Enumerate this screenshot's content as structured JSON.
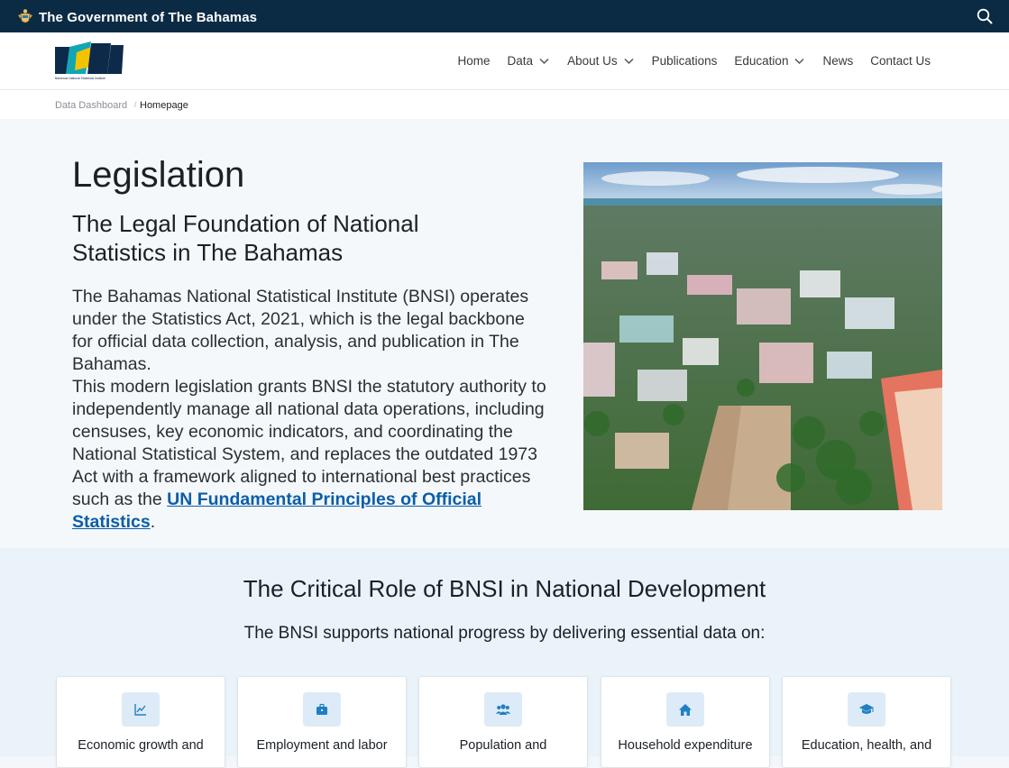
{
  "gov_bar": {
    "title": "The Government of The Bahamas",
    "crest_icon": "coat-of-arms-icon",
    "search_icon": "search-icon"
  },
  "header": {
    "logo_text": "BNSI",
    "logo_caption": "Bahamas National Statistical Institute",
    "nav": [
      {
        "label": "Home",
        "has_dropdown": false
      },
      {
        "label": "Data",
        "has_dropdown": true
      },
      {
        "label": "About Us",
        "has_dropdown": true
      },
      {
        "label": "Publications",
        "has_dropdown": false
      },
      {
        "label": "Education",
        "has_dropdown": true
      },
      {
        "label": "News",
        "has_dropdown": false
      },
      {
        "label": "Contact Us",
        "has_dropdown": false
      }
    ]
  },
  "breadcrumb": {
    "items": [
      "Data Dashboard",
      "Homepage"
    ],
    "separator": "/"
  },
  "hero": {
    "title": "Legislation",
    "subtitle": "The Legal Foundation of National Statistics in The Bahamas",
    "para1": "The Bahamas National Statistical Institute (BNSI) operates under the Statistics Act, 2021, which is the legal backbone for official data collection, analysis, and publication in The Bahamas.",
    "para2_before": "This modern legislation grants BNSI the statutory authority to independently manage all national data operations, including censuses, key economic indicators, and coordinating the National Statistical System, and replaces the outdated 1973 Act with a framework aligned to international best practices such as the ",
    "para2_link": "UN Fundamental Principles of Official Statistics",
    "para2_after": "."
  },
  "role": {
    "title": "The Critical Role of BNSI in National Development",
    "subtitle": "The BNSI supports national progress by delivering essential data on:",
    "cards": [
      {
        "label": "Economic growth and",
        "icon": "line-chart-icon"
      },
      {
        "label": "Employment and labor",
        "icon": "briefcase-icon"
      },
      {
        "label": "Population and",
        "icon": "users-icon"
      },
      {
        "label": "Household expenditure",
        "icon": "home-icon"
      },
      {
        "label": "Education, health, and",
        "icon": "graduation-cap-icon"
      }
    ]
  },
  "colors": {
    "gov_bar": "#0b2a44",
    "link": "#0a5ea8",
    "icon_accent": "#1f7fc4",
    "logo_navy": "#0d2a4a",
    "logo_teal": "#12a6b5",
    "logo_gold": "#f2c300"
  }
}
